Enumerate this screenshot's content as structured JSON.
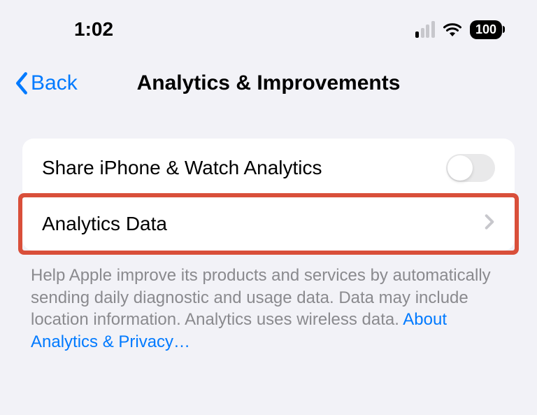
{
  "status": {
    "time": "1:02",
    "battery": "100"
  },
  "nav": {
    "back_label": "Back",
    "title": "Analytics & Improvements"
  },
  "rows": {
    "share": "Share iPhone & Watch Analytics",
    "data": "Analytics Data"
  },
  "footer": {
    "body": "Help Apple improve its products and services by automatically sending daily diagnostic and usage data. Data may include location information. Analytics uses wireless data. ",
    "link": "About Analytics & Privacy…"
  }
}
